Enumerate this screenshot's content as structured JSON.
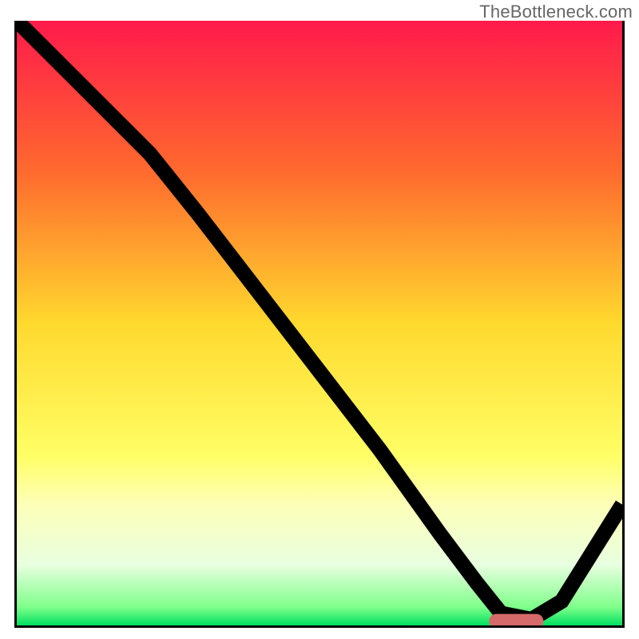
{
  "watermark": "TheBottleneck.com",
  "colors": {
    "watermark": "#666666",
    "curve": "#000000",
    "marker": "#d66a6a",
    "gradient_stops": [
      {
        "offset": 0.0,
        "color": "#ff1a4b"
      },
      {
        "offset": 0.25,
        "color": "#ff6a2e"
      },
      {
        "offset": 0.5,
        "color": "#ffd92e"
      },
      {
        "offset": 0.72,
        "color": "#ffff66"
      },
      {
        "offset": 0.8,
        "color": "#fdffb8"
      },
      {
        "offset": 0.9,
        "color": "#e8ffe0"
      },
      {
        "offset": 0.97,
        "color": "#7fff8a"
      },
      {
        "offset": 1.0,
        "color": "#00e060"
      }
    ]
  },
  "chart_data": {
    "type": "line",
    "title": "",
    "xlabel": "",
    "ylabel": "",
    "xlim": [
      0,
      100
    ],
    "ylim": [
      0,
      100
    ],
    "grid": false,
    "series": [
      {
        "name": "curve",
        "x": [
          0,
          10,
          22,
          30,
          40,
          50,
          60,
          70,
          76,
          80,
          85,
          90,
          100
        ],
        "y": [
          100,
          90,
          78,
          68,
          55,
          42,
          29,
          15,
          7,
          2,
          1,
          4,
          20
        ]
      }
    ],
    "marker": {
      "x_start": 78,
      "x_end": 87,
      "y": 0.7,
      "rx": 1.2
    }
  }
}
